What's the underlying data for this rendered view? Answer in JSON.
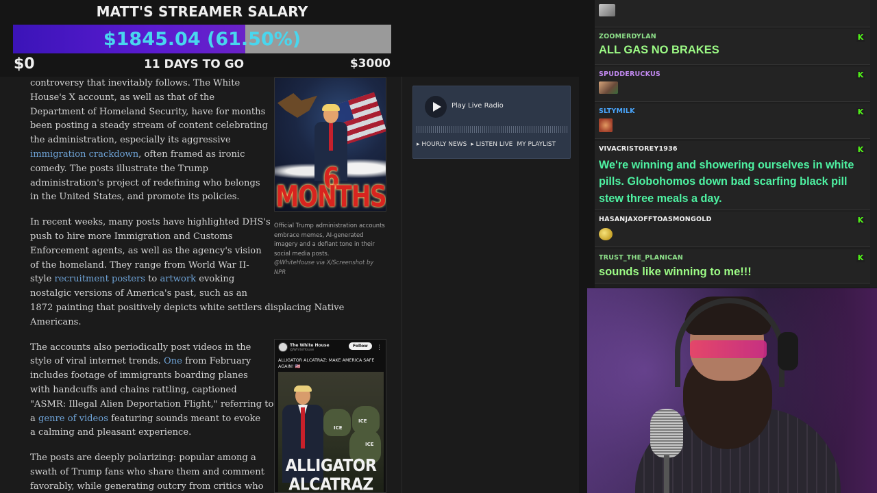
{
  "overlay": {
    "title": "MATT'S STREAMER SALARY",
    "progress_text": "$1845.04 (61.50%)",
    "progress_fraction": 0.615,
    "min_label": "$0",
    "days_label": "11 DAYS TO GO",
    "max_label": "$3000",
    "colors": {
      "fill": "#4a18c8",
      "remaining": "#9a9a9a",
      "text": "#49d6ee"
    }
  },
  "article": {
    "p1": {
      "a": "controversy that inevitably follows. The White",
      "b": "House's X account, as well as that of the",
      "c": "Department of Homeland Security, have for months",
      "d": "been posting a steady stream of content celebrating",
      "e": "the administration, especially its aggressive",
      "link": "immigration crackdown",
      "f": ", often framed as ironic",
      "g": "comedy. The posts illustrate the Trump",
      "h": "administration's project of redefining who belongs",
      "i": "in the United States, and promote its policies."
    },
    "p2": {
      "a": "In recent weeks, many posts have highlighted DHS's",
      "b": "push to hire more Immigration and Customs",
      "c": "Enforcement agents, as well as the agency's vision",
      "d": "of the homeland. They range from World War II-",
      "e": "style ",
      "link1": "recruitment posters",
      "f": " to ",
      "link2": "artwork",
      "g": " evoking",
      "h": "nostalgic versions of America's past, such as an",
      "i": "1872 painting that positively depicts white settlers displacing Native",
      "j": "Americans."
    },
    "p3": {
      "a": "The accounts also periodically post videos in the",
      "b": "style of viral internet trends. ",
      "link1": "One",
      "c": " from February",
      "d": "includes footage of immigrants boarding planes",
      "e": "with handcuffs and chains rattling, captioned",
      "f": "\"ASMR: Illegal Alien Deportation Flight,\" referring to",
      "g": "a ",
      "link2": "genre of videos",
      "h": " featuring sounds meant to evoke",
      "i": "a calming and pleasant experience."
    },
    "p4": {
      "a": "The posts are deeply polarizing: popular among a",
      "b": "swath of Trump fans who share them and comment",
      "c": "favorably, while generating outcry from critics who"
    },
    "figure1": {
      "poster_text": "6 MONTHS",
      "caption": "Official Trump administration accounts embrace memes, AI-generated imagery and a defiant tone in their social media posts.",
      "credit": "@WhiteHouse via X/Screenshot by NPR"
    },
    "figure2": {
      "account_name": "The White House",
      "account_handle": "@WhiteHouse",
      "follow_label": "Follow",
      "more": "⋮",
      "tweet_text": "ALLIGATOR ALCATRAZ: MAKE AMERICA SAFE AGAIN! 🇺🇸",
      "ice_label": "ICE",
      "image_text_1": "ALLIGATOR",
      "image_text_2": "ALCATRAZ"
    }
  },
  "radio": {
    "play_label": "Play Live Radio",
    "links": [
      "▸ HOURLY NEWS",
      "▸ LISTEN LIVE",
      "MY PLAYLIST"
    ]
  },
  "chat": {
    "badge": "K",
    "messages": [
      {
        "user": "ZOOMERDYLAN",
        "user_color": "#8ee08a",
        "text": "ALL GAS NO BRAKES",
        "text_color": "#9dfc86"
      },
      {
        "user": "SPUDDERUCKUS",
        "user_color": "#c38af2",
        "emote": "emote"
      },
      {
        "user": "SLTYMILK",
        "user_color": "#4aa7ff",
        "emote": "emote"
      },
      {
        "user": "VIVACRISTOREY1936",
        "user_color": "#f0f0f0",
        "text": "We're winning and showering ourselves in white pills. Globohomos down bad scarfing black pill stew three meals a day.",
        "text_color": "#4ef2a2"
      },
      {
        "user": "HASANJAXOFFTOASMONGOLD",
        "user_color": "#f0f0f0",
        "emote": "emote"
      },
      {
        "user": "TRUST_THE_PLANICAN",
        "user_color": "#8ee08a",
        "text": "sounds like winning to me!!!",
        "text_color": "#9dfc86"
      }
    ]
  }
}
